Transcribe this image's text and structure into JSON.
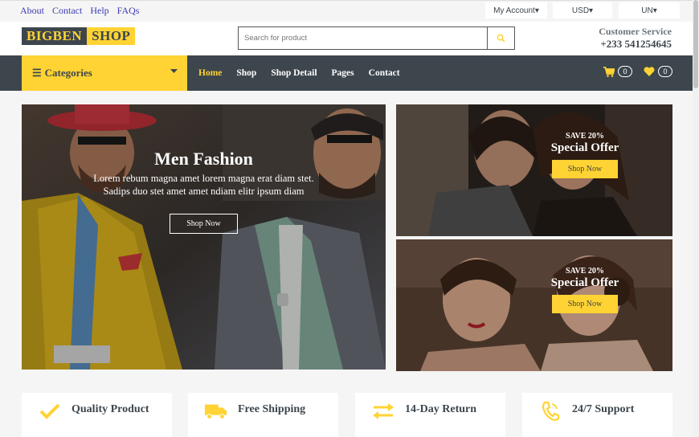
{
  "topbar": {
    "links": [
      "About",
      "Contact",
      "Help",
      "FAQs"
    ],
    "account": "My Account",
    "currency": "USD",
    "language": "UN"
  },
  "logo": {
    "part1": "BIGBEN",
    "part2": "SHOP"
  },
  "search": {
    "placeholder": "Search for product"
  },
  "customer_service": {
    "title": "Customer Service",
    "phone": "+233 541254645"
  },
  "nav": {
    "categories": "Categories",
    "items": [
      "Home",
      "Shop",
      "Shop Detail",
      "Pages",
      "Contact"
    ],
    "cart_count": "0",
    "wishlist_count": "0"
  },
  "hero": {
    "title": "Men Fashion",
    "text_line1": "Lorem rebum magna amet lorem magna erat diam stet.",
    "text_line2": "Sadips duo stet amet amet ndiam elitr ipsum diam",
    "button": "Shop Now"
  },
  "offers": [
    {
      "save": "SAVE 20%",
      "title": "Special Offer",
      "button": "Shop Now"
    },
    {
      "save": "SAVE 20%",
      "title": "Special Offer",
      "button": "Shop Now"
    }
  ],
  "features": [
    {
      "label": "Quality Product",
      "icon": "check-icon"
    },
    {
      "label": "Free Shipping",
      "icon": "truck-icon"
    },
    {
      "label": "14-Day Return",
      "icon": "exchange-icon"
    },
    {
      "label": "24/7 Support",
      "icon": "phone-icon"
    }
  ],
  "colors": {
    "accent": "#FFD333",
    "dark": "#3D464D",
    "link": "#3D3BB0"
  }
}
